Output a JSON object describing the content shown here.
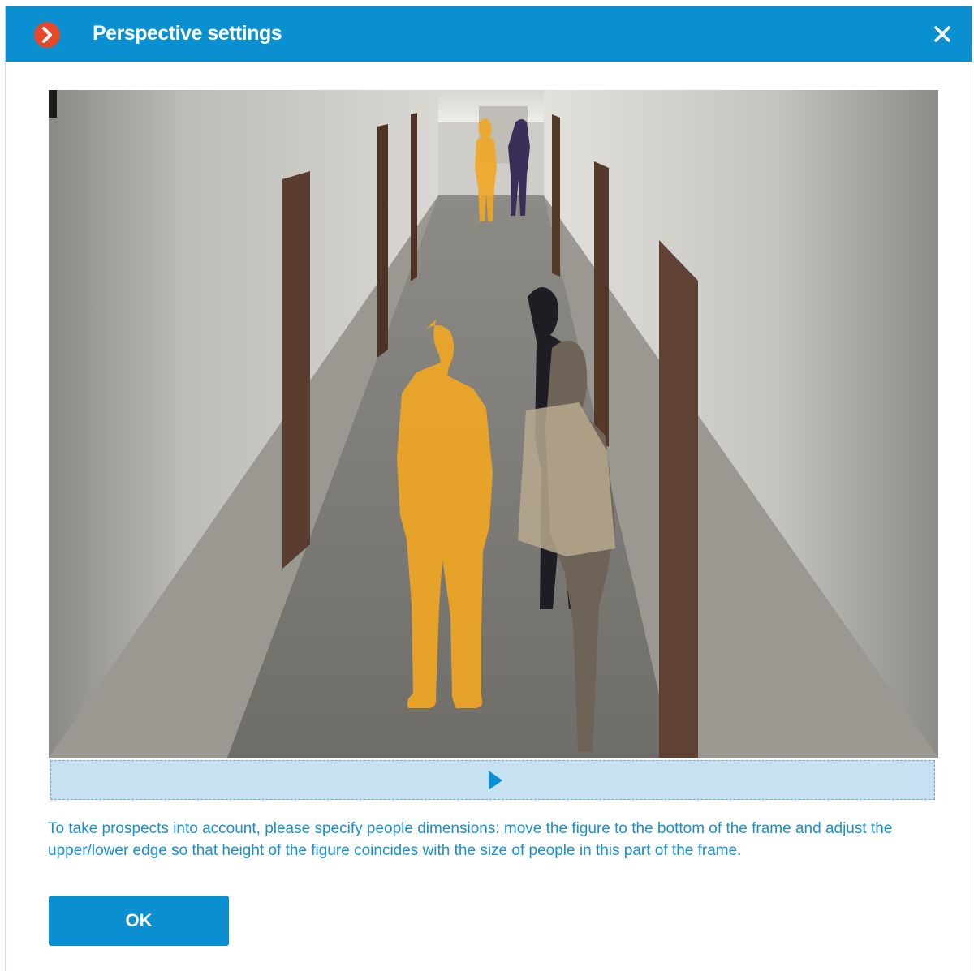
{
  "window": {
    "title": "Perspective settings",
    "close_icon": "close-icon",
    "logo_icon": "app-logo-icon"
  },
  "colors": {
    "accent": "#0a8fd0",
    "figure": "#f0a623",
    "playbar": "#c6e1f2",
    "hint_text": "#1a8fd0"
  },
  "video": {
    "scene": "corridor-camera-frame",
    "play_icon": "play-icon"
  },
  "hint": {
    "text": "To take prospects into account, please specify people dimensions: move the figure to the bottom of the frame and adjust the upper/lower edge so that height of the figure coincides with the size of people in this part of the frame."
  },
  "buttons": {
    "ok_label": "OK"
  }
}
